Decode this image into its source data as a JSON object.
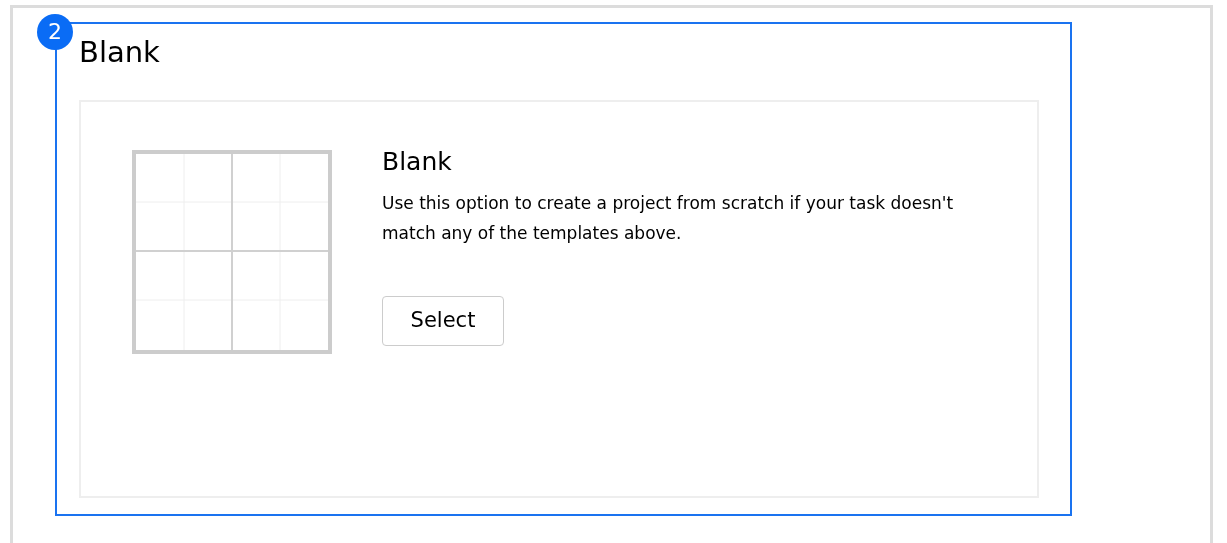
{
  "annotation": {
    "number": "2"
  },
  "section": {
    "title": "Blank"
  },
  "card": {
    "title": "Blank",
    "description": "Use this option to create a project from scratch if your task doesn't match any of the templates above.",
    "button": "Select"
  }
}
